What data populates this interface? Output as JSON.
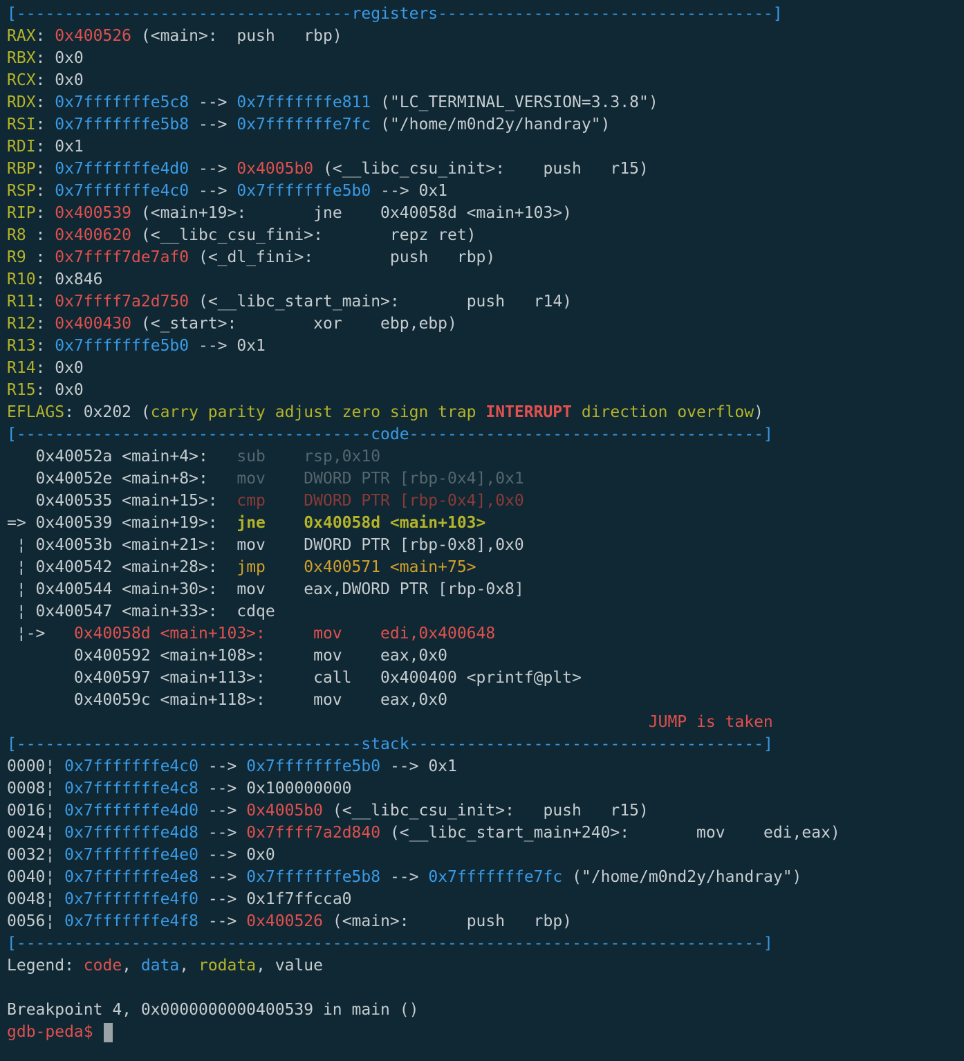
{
  "colors": {
    "background": "#0f2833",
    "text": "#c6ccd0",
    "yellow": "#b5b32a",
    "red": "#e0504e",
    "blue": "#3a9ae6",
    "dim": "#55666e",
    "dim_red": "#8b3a38",
    "orange": "#d2a02c"
  },
  "lines": [
    {
      "id": "header-registers",
      "segs": [
        {
          "t": "[-----------------------------------",
          "c": "b"
        },
        {
          "t": "registers",
          "c": "b"
        },
        {
          "t": "-----------------------------------]",
          "c": "b"
        }
      ]
    },
    {
      "id": "reg-rax",
      "segs": [
        {
          "t": "RAX",
          "c": "y"
        },
        {
          "t": ": ",
          "c": "t"
        },
        {
          "t": "0x400526",
          "c": "r"
        },
        {
          "t": " (<main>:  push   rbp)",
          "c": "t"
        }
      ]
    },
    {
      "id": "reg-rbx",
      "segs": [
        {
          "t": "RBX",
          "c": "y"
        },
        {
          "t": ": 0x0",
          "c": "t"
        }
      ]
    },
    {
      "id": "reg-rcx",
      "segs": [
        {
          "t": "RCX",
          "c": "y"
        },
        {
          "t": ": 0x0",
          "c": "t"
        }
      ]
    },
    {
      "id": "reg-rdx",
      "segs": [
        {
          "t": "RDX",
          "c": "y"
        },
        {
          "t": ": ",
          "c": "t"
        },
        {
          "t": "0x7fffffffe5c8",
          "c": "b"
        },
        {
          "t": " --> ",
          "c": "t"
        },
        {
          "t": "0x7fffffffe811",
          "c": "b"
        },
        {
          "t": " (\"LC_TERMINAL_VERSION=3.3.8\")",
          "c": "t"
        }
      ]
    },
    {
      "id": "reg-rsi",
      "segs": [
        {
          "t": "RSI",
          "c": "y"
        },
        {
          "t": ": ",
          "c": "t"
        },
        {
          "t": "0x7fffffffe5b8",
          "c": "b"
        },
        {
          "t": " --> ",
          "c": "t"
        },
        {
          "t": "0x7fffffffe7fc",
          "c": "b"
        },
        {
          "t": " (\"/home/m0nd2y/handray\")",
          "c": "t"
        }
      ]
    },
    {
      "id": "reg-rdi",
      "segs": [
        {
          "t": "RDI",
          "c": "y"
        },
        {
          "t": ": 0x1",
          "c": "t"
        }
      ]
    },
    {
      "id": "reg-rbp",
      "segs": [
        {
          "t": "RBP",
          "c": "y"
        },
        {
          "t": ": ",
          "c": "t"
        },
        {
          "t": "0x7fffffffe4d0",
          "c": "b"
        },
        {
          "t": " --> ",
          "c": "t"
        },
        {
          "t": "0x4005b0",
          "c": "r"
        },
        {
          "t": " (<__libc_csu_init>:    push   r15)",
          "c": "t"
        }
      ]
    },
    {
      "id": "reg-rsp",
      "segs": [
        {
          "t": "RSP",
          "c": "y"
        },
        {
          "t": ": ",
          "c": "t"
        },
        {
          "t": "0x7fffffffe4c0",
          "c": "b"
        },
        {
          "t": " --> ",
          "c": "t"
        },
        {
          "t": "0x7fffffffe5b0",
          "c": "b"
        },
        {
          "t": " --> 0x1",
          "c": "t"
        }
      ]
    },
    {
      "id": "reg-rip",
      "segs": [
        {
          "t": "RIP",
          "c": "y"
        },
        {
          "t": ": ",
          "c": "t"
        },
        {
          "t": "0x400539",
          "c": "r"
        },
        {
          "t": " (<main+19>:       jne    0x40058d <main+103>)",
          "c": "t"
        }
      ]
    },
    {
      "id": "reg-r8",
      "segs": [
        {
          "t": "R8 ",
          "c": "y"
        },
        {
          "t": ": ",
          "c": "t"
        },
        {
          "t": "0x400620",
          "c": "r"
        },
        {
          "t": " (<__libc_csu_fini>:       repz ret)",
          "c": "t"
        }
      ]
    },
    {
      "id": "reg-r9",
      "segs": [
        {
          "t": "R9 ",
          "c": "y"
        },
        {
          "t": ": ",
          "c": "t"
        },
        {
          "t": "0x7ffff7de7af0",
          "c": "r"
        },
        {
          "t": " (<_dl_fini>:        push   rbp)",
          "c": "t"
        }
      ]
    },
    {
      "id": "reg-r10",
      "segs": [
        {
          "t": "R10",
          "c": "y"
        },
        {
          "t": ": 0x846",
          "c": "t"
        }
      ]
    },
    {
      "id": "reg-r11",
      "segs": [
        {
          "t": "R11",
          "c": "y"
        },
        {
          "t": ": ",
          "c": "t"
        },
        {
          "t": "0x7ffff7a2d750",
          "c": "r"
        },
        {
          "t": " (<__libc_start_main>:       push   r14)",
          "c": "t"
        }
      ]
    },
    {
      "id": "reg-r12",
      "segs": [
        {
          "t": "R12",
          "c": "y"
        },
        {
          "t": ": ",
          "c": "t"
        },
        {
          "t": "0x400430",
          "c": "r"
        },
        {
          "t": " (<_start>:        xor    ebp,ebp)",
          "c": "t"
        }
      ]
    },
    {
      "id": "reg-r13",
      "segs": [
        {
          "t": "R13",
          "c": "y"
        },
        {
          "t": ": ",
          "c": "t"
        },
        {
          "t": "0x7fffffffe5b0",
          "c": "b"
        },
        {
          "t": " --> 0x1",
          "c": "t"
        }
      ]
    },
    {
      "id": "reg-r14",
      "segs": [
        {
          "t": "R14",
          "c": "y"
        },
        {
          "t": ": 0x0",
          "c": "t"
        }
      ]
    },
    {
      "id": "reg-r15",
      "segs": [
        {
          "t": "R15",
          "c": "y"
        },
        {
          "t": ": 0x0",
          "c": "t"
        }
      ]
    },
    {
      "id": "reg-eflags",
      "segs": [
        {
          "t": "EFLAGS",
          "c": "y"
        },
        {
          "t": ": 0x202 (",
          "c": "t"
        },
        {
          "t": "carry parity adjust zero sign trap ",
          "c": "y"
        },
        {
          "t": "INTERRUPT",
          "c": "rb"
        },
        {
          "t": " direction overflow",
          "c": "y"
        },
        {
          "t": ")",
          "c": "t"
        }
      ]
    },
    {
      "id": "header-code",
      "segs": [
        {
          "t": "[-------------------------------------",
          "c": "b"
        },
        {
          "t": "code",
          "c": "b"
        },
        {
          "t": "-------------------------------------]",
          "c": "b"
        }
      ]
    },
    {
      "id": "code-line-1",
      "segs": [
        {
          "t": "   0x40052a <main+4>:   ",
          "c": "t"
        },
        {
          "t": "sub    rsp,0x10",
          "c": "d"
        }
      ]
    },
    {
      "id": "code-line-2",
      "segs": [
        {
          "t": "   0x40052e <main+8>:   ",
          "c": "t"
        },
        {
          "t": "mov    DWORD PTR [rbp-0x4],0x1",
          "c": "d"
        }
      ]
    },
    {
      "id": "code-line-3",
      "segs": [
        {
          "t": "   0x400535 <main+15>:  ",
          "c": "t"
        },
        {
          "t": "cmp    DWORD PTR [rbp-0x4],0x0",
          "c": "dr"
        }
      ]
    },
    {
      "id": "code-line-current",
      "segs": [
        {
          "t": "=> 0x400539 <main+19>:  ",
          "c": "t"
        },
        {
          "t": "jne    0x40058d <main+103>",
          "c": "yb"
        }
      ]
    },
    {
      "id": "code-line-5",
      "segs": [
        {
          "t": " ¦ 0x40053b <main+21>:  mov    DWORD PTR [rbp-0x8],0x0",
          "c": "t"
        }
      ]
    },
    {
      "id": "code-line-6",
      "segs": [
        {
          "t": " ¦ 0x400542 <main+28>:  ",
          "c": "t"
        },
        {
          "t": "jmp    0x400571 <main+75>",
          "c": "o"
        }
      ]
    },
    {
      "id": "code-line-7",
      "segs": [
        {
          "t": " ¦ 0x400544 <main+30>:  mov    eax,DWORD PTR [rbp-0x8]",
          "c": "t"
        }
      ]
    },
    {
      "id": "code-line-8",
      "segs": [
        {
          "t": " ¦ 0x400547 <main+33>:  cdqe",
          "c": "t"
        }
      ]
    },
    {
      "id": "code-line-target",
      "segs": [
        {
          "t": " ¦->   ",
          "c": "t"
        },
        {
          "t": "0x40058d <main+103>:     mov    edi,0x400648",
          "c": "r"
        }
      ]
    },
    {
      "id": "code-line-10",
      "segs": [
        {
          "t": "       0x400592 <main+108>:     mov    eax,0x0",
          "c": "t"
        }
      ]
    },
    {
      "id": "code-line-11",
      "segs": [
        {
          "t": "       0x400597 <main+113>:     call   0x400400 <printf@plt>",
          "c": "t"
        }
      ]
    },
    {
      "id": "code-line-12",
      "segs": [
        {
          "t": "       0x40059c <main+118>:     mov    eax,0x0",
          "c": "t"
        }
      ]
    },
    {
      "id": "jump-status",
      "segs": [
        {
          "t": "                                                                   ",
          "c": "t"
        },
        {
          "t": "JUMP is taken",
          "c": "r"
        }
      ]
    },
    {
      "id": "header-stack",
      "segs": [
        {
          "t": "[------------------------------------",
          "c": "b"
        },
        {
          "t": "stack",
          "c": "b"
        },
        {
          "t": "-------------------------------------]",
          "c": "b"
        }
      ]
    },
    {
      "id": "stack-0000",
      "segs": [
        {
          "t": "0000¦ ",
          "c": "t"
        },
        {
          "t": "0x7fffffffe4c0",
          "c": "b"
        },
        {
          "t": " --> ",
          "c": "t"
        },
        {
          "t": "0x7fffffffe5b0",
          "c": "b"
        },
        {
          "t": " --> 0x1",
          "c": "t"
        }
      ]
    },
    {
      "id": "stack-0008",
      "segs": [
        {
          "t": "0008¦ ",
          "c": "t"
        },
        {
          "t": "0x7fffffffe4c8",
          "c": "b"
        },
        {
          "t": " --> 0x100000000",
          "c": "t"
        }
      ]
    },
    {
      "id": "stack-0016",
      "segs": [
        {
          "t": "0016¦ ",
          "c": "t"
        },
        {
          "t": "0x7fffffffe4d0",
          "c": "b"
        },
        {
          "t": " --> ",
          "c": "t"
        },
        {
          "t": "0x4005b0",
          "c": "r"
        },
        {
          "t": " (<__libc_csu_init>:   push   r15)",
          "c": "t"
        }
      ]
    },
    {
      "id": "stack-0024",
      "segs": [
        {
          "t": "0024¦ ",
          "c": "t"
        },
        {
          "t": "0x7fffffffe4d8",
          "c": "b"
        },
        {
          "t": " --> ",
          "c": "t"
        },
        {
          "t": "0x7ffff7a2d840",
          "c": "r"
        },
        {
          "t": " (<__libc_start_main+240>:       mov    edi,eax)",
          "c": "t"
        }
      ]
    },
    {
      "id": "stack-0032",
      "segs": [
        {
          "t": "0032¦ ",
          "c": "t"
        },
        {
          "t": "0x7fffffffe4e0",
          "c": "b"
        },
        {
          "t": " --> 0x0",
          "c": "t"
        }
      ]
    },
    {
      "id": "stack-0040",
      "segs": [
        {
          "t": "0040¦ ",
          "c": "t"
        },
        {
          "t": "0x7fffffffe4e8",
          "c": "b"
        },
        {
          "t": " --> ",
          "c": "t"
        },
        {
          "t": "0x7fffffffe5b8",
          "c": "b"
        },
        {
          "t": " --> ",
          "c": "t"
        },
        {
          "t": "0x7fffffffe7fc",
          "c": "b"
        },
        {
          "t": " (\"/home/m0nd2y/handray\")",
          "c": "t"
        }
      ]
    },
    {
      "id": "stack-0048",
      "segs": [
        {
          "t": "0048¦ ",
          "c": "t"
        },
        {
          "t": "0x7fffffffe4f0",
          "c": "b"
        },
        {
          "t": " --> 0x1f7ffcca0",
          "c": "t"
        }
      ]
    },
    {
      "id": "stack-0056",
      "segs": [
        {
          "t": "0056¦ ",
          "c": "t"
        },
        {
          "t": "0x7fffffffe4f8",
          "c": "b"
        },
        {
          "t": " --> ",
          "c": "t"
        },
        {
          "t": "0x400526",
          "c": "r"
        },
        {
          "t": " (<main>:      push   rbp)",
          "c": "t"
        }
      ]
    },
    {
      "id": "footer-rule",
      "segs": [
        {
          "t": "[------------------------------------------------------------------------------]",
          "c": "b"
        }
      ]
    },
    {
      "id": "legend",
      "segs": [
        {
          "t": "Legend: ",
          "c": "t"
        },
        {
          "t": "code",
          "c": "r"
        },
        {
          "t": ", ",
          "c": "t"
        },
        {
          "t": "data",
          "c": "b"
        },
        {
          "t": ", ",
          "c": "t"
        },
        {
          "t": "rodata",
          "c": "y"
        },
        {
          "t": ", value",
          "c": "t"
        }
      ]
    },
    {
      "id": "blank-line",
      "segs": [
        {
          "t": " ",
          "c": "t"
        }
      ]
    },
    {
      "id": "breakpoint-message",
      "segs": [
        {
          "t": "Breakpoint 4, 0x0000000000400539 in main ()",
          "c": "t"
        }
      ]
    }
  ],
  "prompt": {
    "text": "gdb-peda$ "
  }
}
